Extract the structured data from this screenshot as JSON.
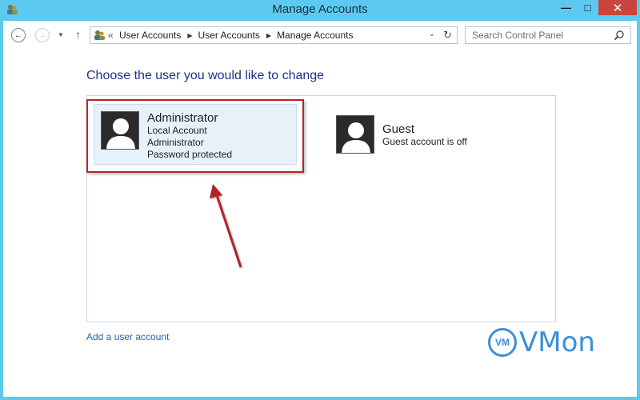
{
  "window": {
    "title": "Manage Accounts",
    "buttons": {
      "minimize": "—",
      "maximize": "□",
      "close": "✕"
    }
  },
  "nav": {
    "back_glyph": "←",
    "forward_glyph": "→",
    "dropdown_glyph": "▼",
    "up_glyph": "↑",
    "chevron": "«",
    "separator": "▶",
    "breadcrumbs": [
      "User Accounts",
      "User Accounts",
      "Manage Accounts"
    ],
    "address_dropdown_glyph": "⌄",
    "refresh_glyph": "↻",
    "search": {
      "placeholder": "Search Control Panel",
      "value": ""
    }
  },
  "main": {
    "heading": "Choose the user you would like to change",
    "accounts": [
      {
        "name": "Administrator",
        "lines": [
          "Local Account",
          "Administrator",
          "Password protected"
        ],
        "selected": true
      },
      {
        "name": "Guest",
        "lines": [
          "Guest account is off"
        ],
        "selected": false
      }
    ],
    "add_user_link": "Add a user account"
  },
  "watermark": {
    "badge": "VM",
    "text": "VMon"
  },
  "colors": {
    "titlebar": "#5ccaf0",
    "heading": "#1e3287",
    "link": "#1e64b4",
    "highlight": "#b5232a",
    "watermark": "#3a8fdc"
  }
}
